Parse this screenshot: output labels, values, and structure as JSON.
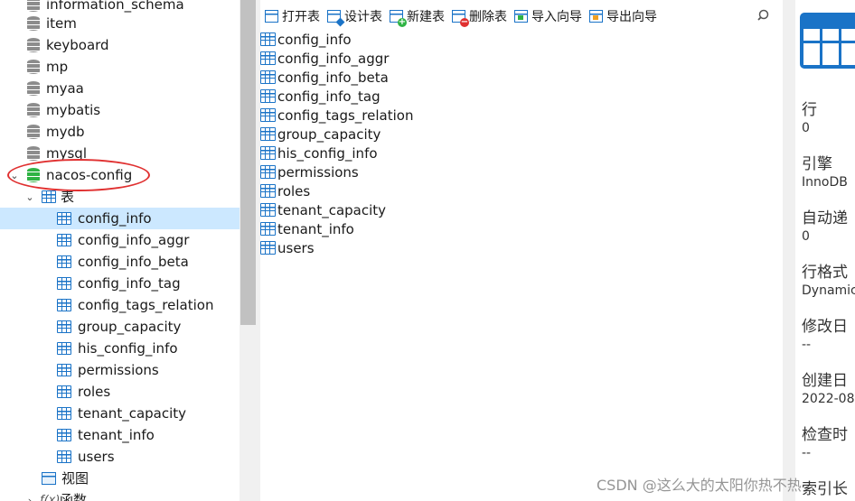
{
  "tree": {
    "databases": [
      {
        "label": "information_schema"
      },
      {
        "label": "item"
      },
      {
        "label": "keyboard"
      },
      {
        "label": "mp"
      },
      {
        "label": "myaa"
      },
      {
        "label": "mybatis"
      },
      {
        "label": "mydb"
      },
      {
        "label": "mysql"
      }
    ],
    "open_db": {
      "label": "nacos-config",
      "icon": "database-green-icon",
      "highlight_color": "#e03030"
    },
    "tables_group": {
      "label": "表"
    },
    "tables": [
      {
        "label": "config_info",
        "selected": true
      },
      {
        "label": "config_info_aggr"
      },
      {
        "label": "config_info_beta"
      },
      {
        "label": "config_info_tag"
      },
      {
        "label": "config_tags_relation"
      },
      {
        "label": "group_capacity"
      },
      {
        "label": "his_config_info"
      },
      {
        "label": "permissions"
      },
      {
        "label": "roles"
      },
      {
        "label": "tenant_capacity"
      },
      {
        "label": "tenant_info"
      },
      {
        "label": "users"
      }
    ],
    "views_group": {
      "label": "视图"
    },
    "functions_group": {
      "label": "函数"
    }
  },
  "toolbar": {
    "open_table": "打开表",
    "design_table": "设计表",
    "new_table": "新建表",
    "delete_table": "删除表",
    "import_wizard": "导入向导",
    "export_wizard": "导出向导"
  },
  "objects": [
    "config_info",
    "config_info_aggr",
    "config_info_beta",
    "config_info_tag",
    "config_tags_relation",
    "group_capacity",
    "his_config_info",
    "permissions",
    "roles",
    "tenant_capacity",
    "tenant_info",
    "users"
  ],
  "info": {
    "rows_label": "行",
    "rows_value": "0",
    "engine_label": "引擎",
    "engine_value": "InnoDB",
    "auto_inc_label": "自动递",
    "auto_inc_value": "0",
    "row_format_label": "行格式",
    "row_format_value": "Dynamic",
    "modified_label": "修改日",
    "modified_value": "--",
    "created_label": "创建日",
    "created_value": "2022-08",
    "checked_label": "检查时",
    "checked_value": "--",
    "index_label": "索引长"
  },
  "watermark": "CSDN @这么大的太阳你热不热",
  "colors": {
    "selection": "#cce8ff",
    "table_icon": "#1a73c7",
    "db_open": "#2fb344",
    "annotation": "#e03030"
  }
}
